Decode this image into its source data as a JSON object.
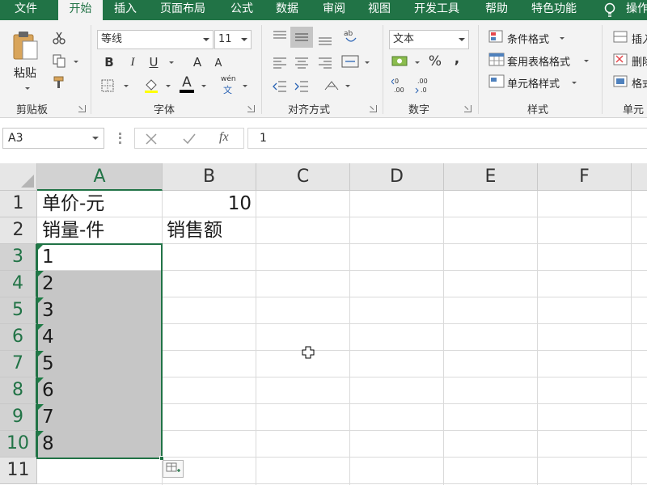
{
  "menu": {
    "tabs": [
      {
        "label": "文件",
        "active": false
      },
      {
        "label": "开始",
        "active": true
      },
      {
        "label": "插入",
        "active": false
      },
      {
        "label": "页面布局",
        "active": false
      },
      {
        "label": "公式",
        "active": false
      },
      {
        "label": "数据",
        "active": false
      },
      {
        "label": "审阅",
        "active": false
      },
      {
        "label": "视图",
        "active": false
      },
      {
        "label": "开发工具",
        "active": false
      },
      {
        "label": "帮助",
        "active": false
      },
      {
        "label": "特色功能",
        "active": false
      }
    ],
    "tell_me": "操作"
  },
  "ribbon": {
    "clipboard": {
      "label": "剪贴板",
      "paste": "粘贴"
    },
    "font": {
      "label": "字体",
      "font_name": "等线",
      "font_size": "11",
      "bold": "B",
      "italic": "I",
      "underline": "U",
      "grow": "A",
      "shrink": "A",
      "font_color": "A",
      "phonetic": "wén",
      "phonetic_char": "文"
    },
    "alignment": {
      "label": "对齐方式"
    },
    "number": {
      "label": "数字",
      "format": "文本",
      "percent": "%",
      "comma": ","
    },
    "styles": {
      "label": "样式",
      "conditional_formatting": "条件格式",
      "format_as_table": "套用表格格式",
      "cell_styles": "单元格样式"
    },
    "cells": {
      "label": "单元",
      "insert": "插入",
      "delete": "删除",
      "format": "格式"
    }
  },
  "formula_bar": {
    "name_box": "A3",
    "fx": "fx",
    "value": "1"
  },
  "grid": {
    "columns": [
      "A",
      "B",
      "C",
      "D",
      "E",
      "F"
    ],
    "rows": [
      "1",
      "2",
      "3",
      "4",
      "5",
      "6",
      "7",
      "8",
      "9",
      "10",
      "11"
    ],
    "active_column": "A",
    "selected_rows": [
      "3",
      "4",
      "5",
      "6",
      "7",
      "8",
      "9",
      "10"
    ],
    "cells": {
      "A1": "单价-元",
      "B1": "10",
      "A2": "销量-件",
      "B2": "销售额",
      "A3": "1",
      "A4": "2",
      "A5": "3",
      "A6": "4",
      "A7": "5",
      "A8": "6",
      "A9": "7",
      "A10": "8"
    }
  },
  "colors": {
    "accent": "#217346",
    "selection_fill": "#c6c6c6",
    "error_triangle": "#1e7b45"
  }
}
